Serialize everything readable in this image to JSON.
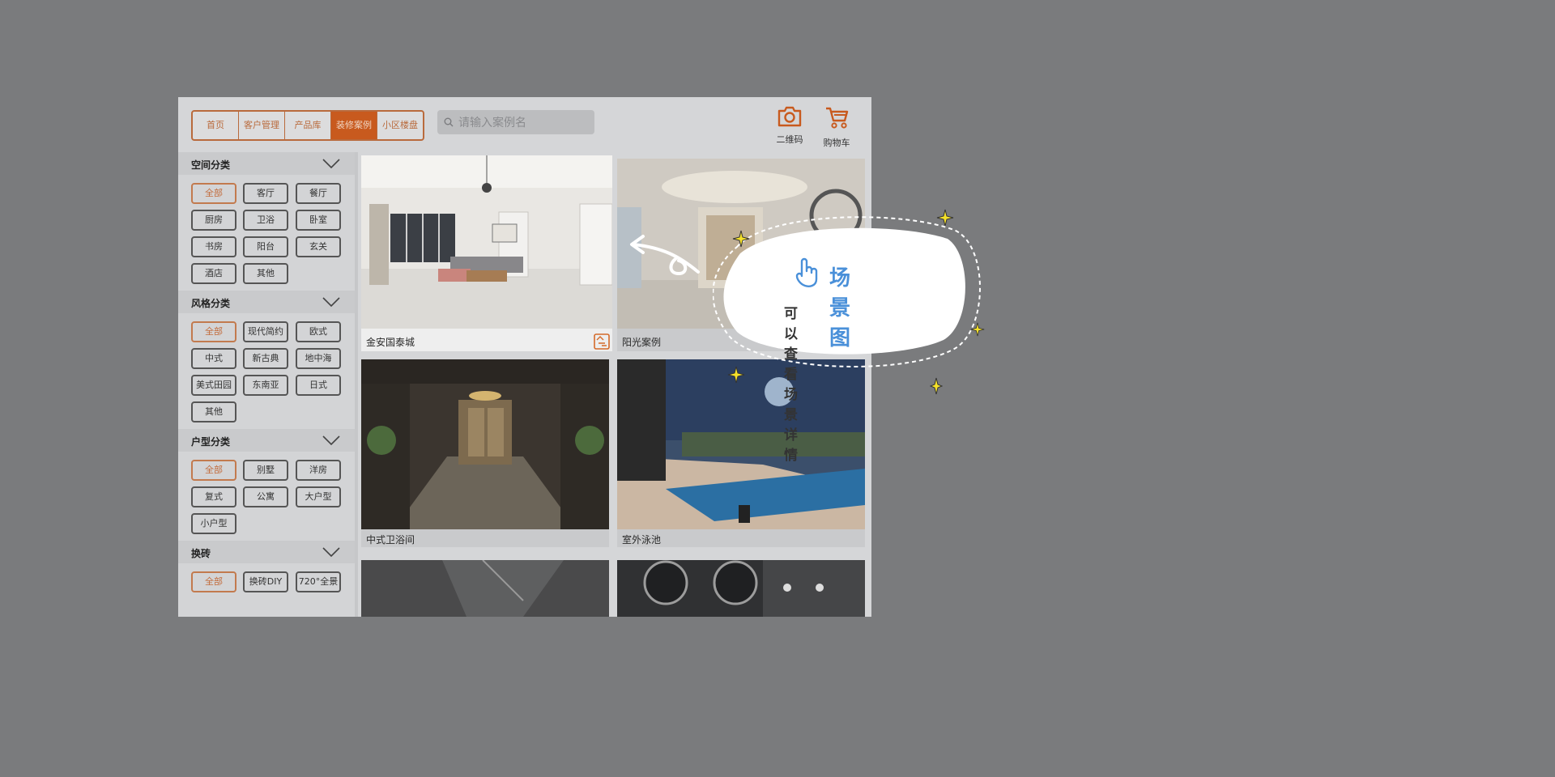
{
  "nav": {
    "items": [
      "首页",
      "客户管理",
      "产品库",
      "装修案例",
      "小区楼盘"
    ],
    "active_index": 3
  },
  "search": {
    "placeholder": "请输入案例名"
  },
  "tools": {
    "qrcode_label": "二维码",
    "cart_label": "购物车"
  },
  "filters": [
    {
      "title": "空间分类",
      "tags": [
        "全部",
        "客厅",
        "餐厅",
        "厨房",
        "卫浴",
        "卧室",
        "书房",
        "阳台",
        "玄关",
        "酒店",
        "其他"
      ]
    },
    {
      "title": "风格分类",
      "tags": [
        "全部",
        "现代简约",
        "欧式",
        "中式",
        "新古典",
        "地中海",
        "美式田园",
        "东南亚",
        "日式",
        "其他"
      ]
    },
    {
      "title": "户型分类",
      "tags": [
        "全部",
        "别墅",
        "洋房",
        "复式",
        "公寓",
        "大户型",
        "小户型"
      ]
    },
    {
      "title": "换砖",
      "tags": [
        "全部",
        "换砖DIY",
        "720°全景"
      ]
    }
  ],
  "cases": [
    {
      "name": "金安国泰城"
    },
    {
      "name": "阳光案例"
    },
    {
      "name": "中式卫浴间"
    },
    {
      "name": "室外泳池"
    },
    {
      "name": ""
    },
    {
      "name": ""
    }
  ],
  "callout": {
    "title": "场景图",
    "subtitle": "可以查看场景详情"
  },
  "colors": {
    "accent": "#c85a1e",
    "callout_title": "#4a90d9",
    "sparkle": "#f5e12a"
  }
}
